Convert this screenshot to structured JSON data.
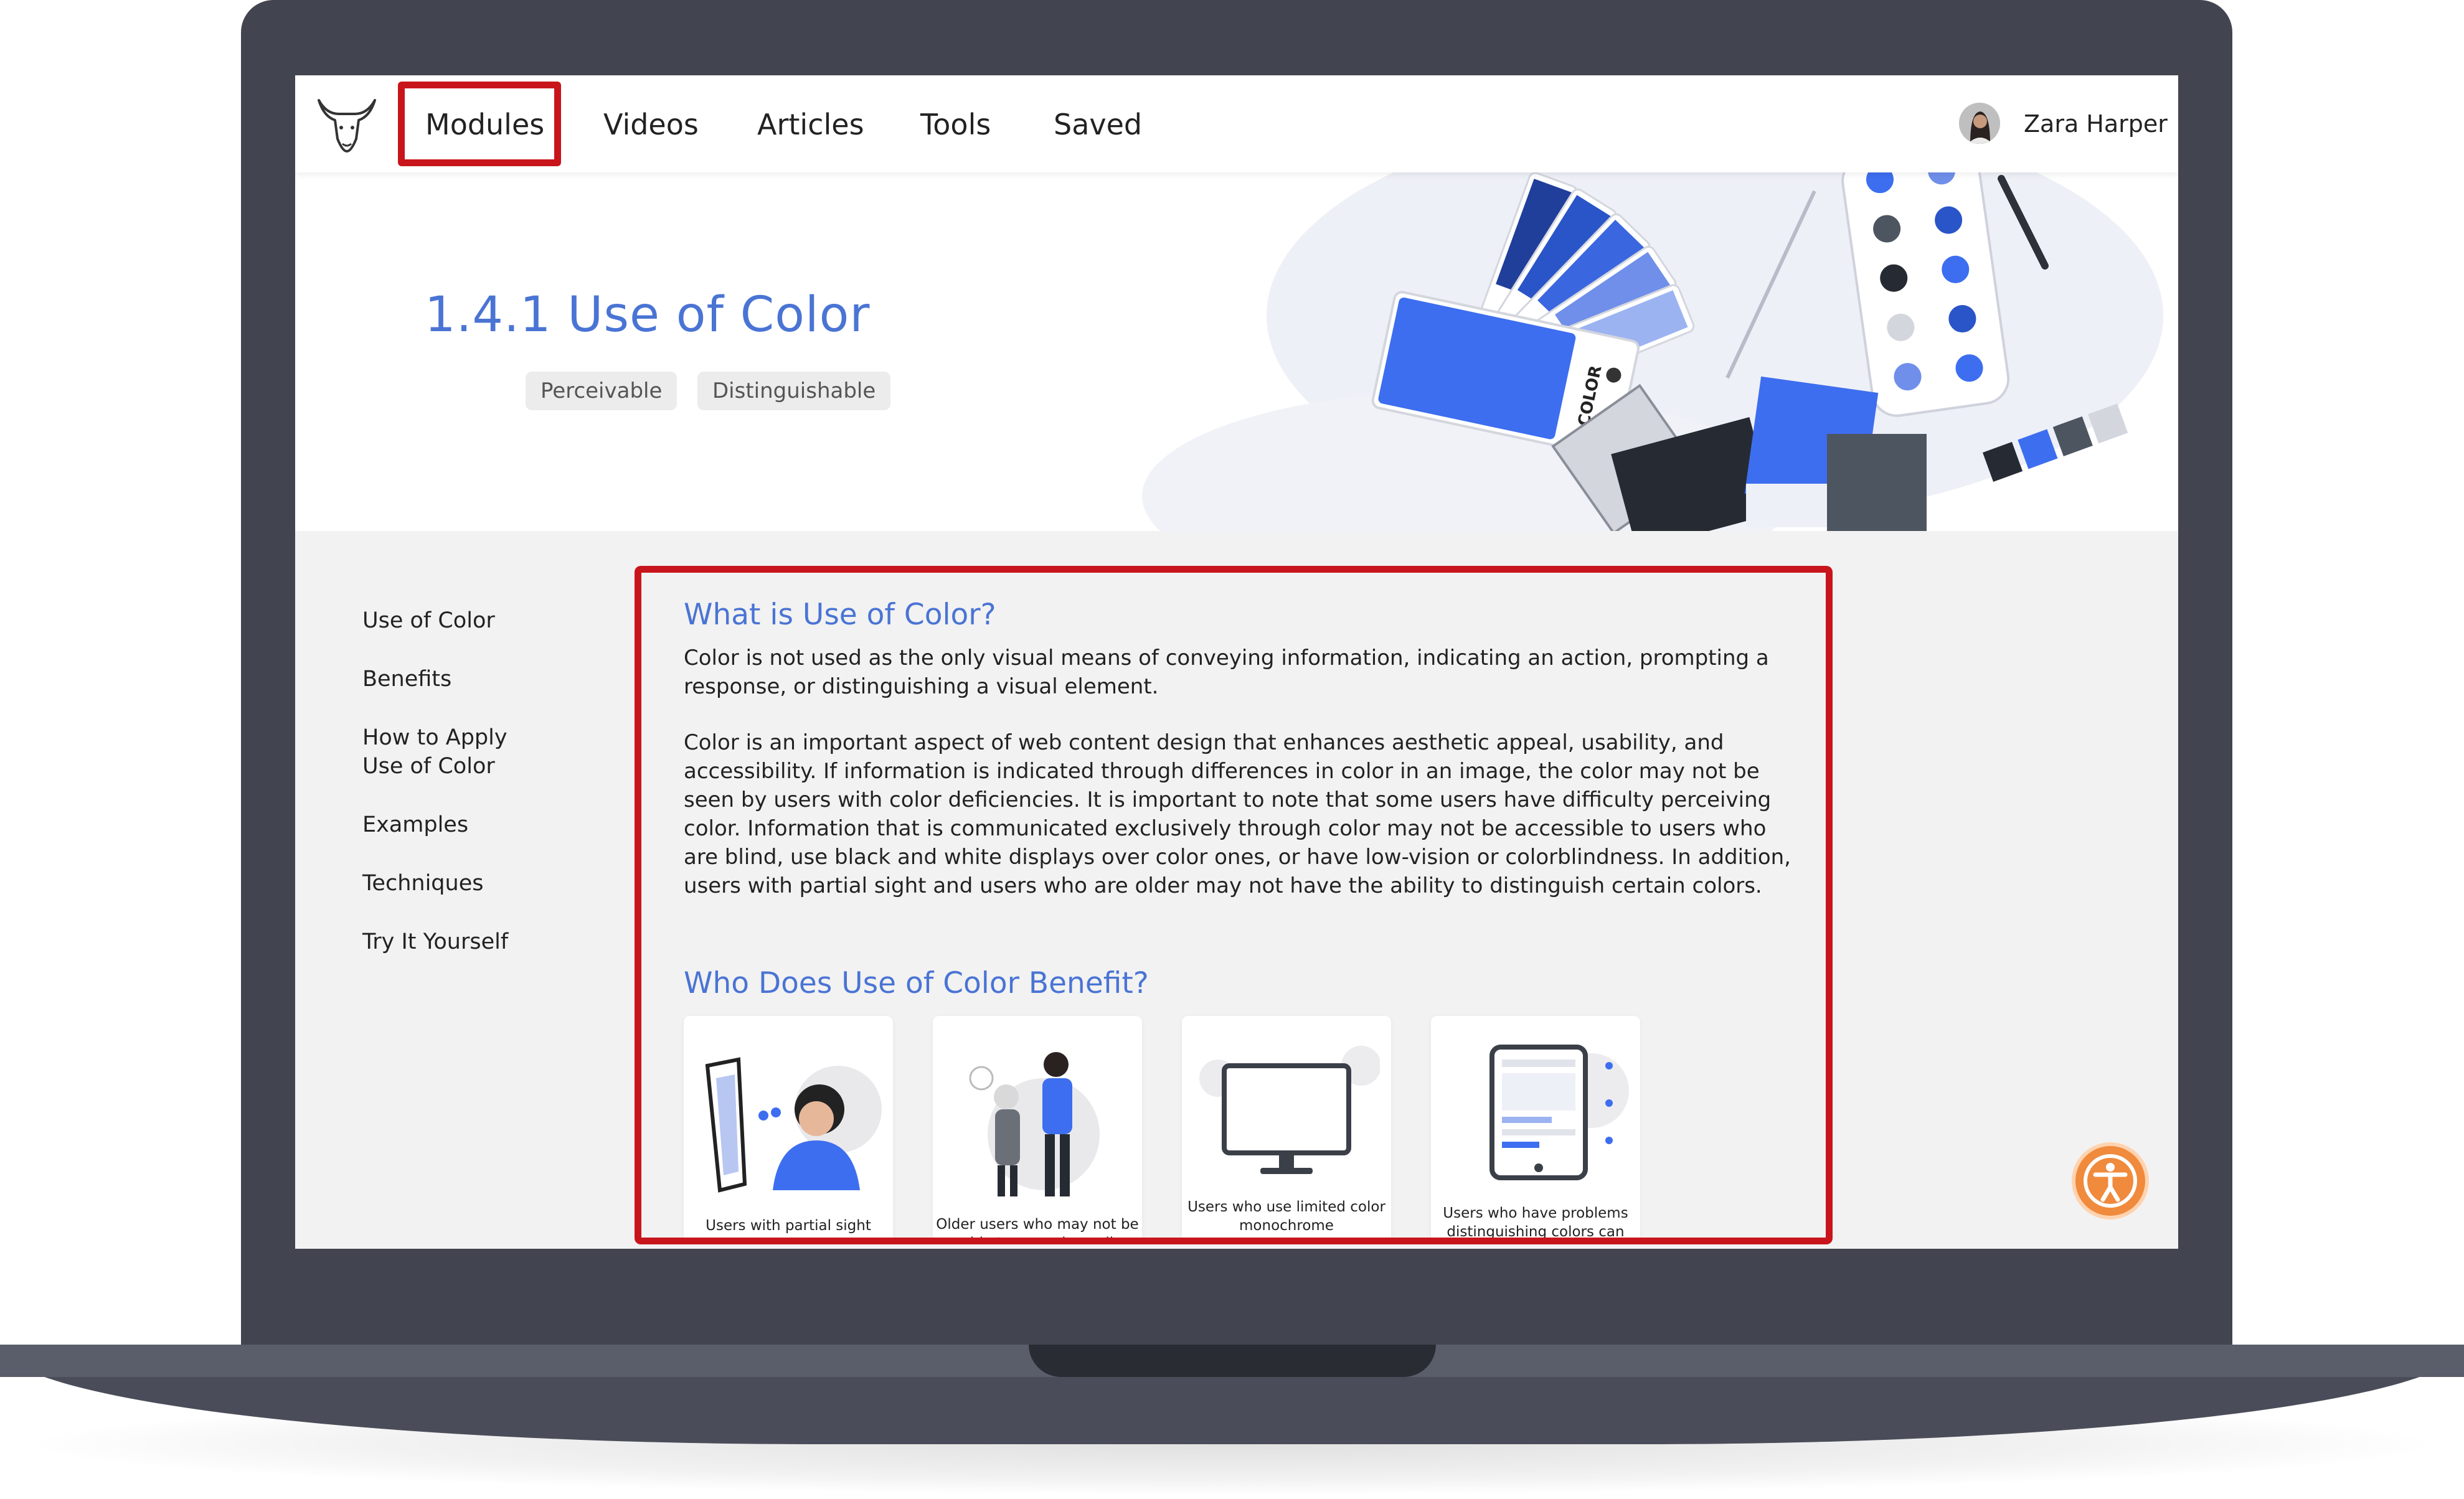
{
  "nav": {
    "items": [
      "Modules",
      "Videos",
      "Articles",
      "Tools",
      "Saved"
    ],
    "user_name": "Zara Harper"
  },
  "hero": {
    "title": "1.4.1 Use of Color",
    "tags": [
      "Perceivable",
      "Distinguishable"
    ],
    "swatch_label": "COLOR"
  },
  "sidebar": {
    "items": [
      "Use of Color",
      "Benefits",
      "How to Apply",
      "Use of Color",
      "Examples",
      "Techniques",
      "Try It Yourself"
    ]
  },
  "main": {
    "section1_title": "What is Use of Color?",
    "paragraph1": "Color is not used as the only visual means of conveying information, indicating an action, prompting a response, or distinguishing a visual element.",
    "paragraph2": "Color is an important aspect of web content design that enhances aesthetic appeal, usability, and accessibility. If information is indicated through differences in color in an image, the color may not be seen by users with color deficiencies. It is important to note that some users have difficulty perceiving color. Information that is communicated exclusively through color may not be accessible to users who are blind, use black and white displays over color ones, or have low-vision or colorblindness. In addition, users with partial sight and users who are older may not have the ability to distinguish certain colors.",
    "section2_title": "Who Does Use of Color Benefit?",
    "cards": [
      {
        "caption": "Users with partial sight"
      },
      {
        "caption": "Older users who may not be able to see color well"
      },
      {
        "caption": "Users who use limited color monochrome"
      },
      {
        "caption": "Users who have problems distinguishing colors can"
      }
    ]
  },
  "colors": {
    "accent": "#4a74d4",
    "highlight_border": "#c8151c",
    "frame": "#424450",
    "a11y_button": "#f08a3c"
  },
  "icons": [
    "bull-logo-icon",
    "accessibility-icon"
  ]
}
